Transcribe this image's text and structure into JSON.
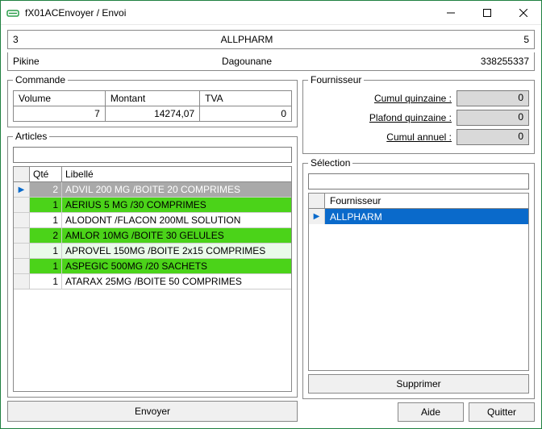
{
  "window": {
    "title": "fX01ACEnvoyer / Envoi"
  },
  "info1": {
    "left": "3",
    "center": "ALLPHARM",
    "right": "5"
  },
  "info2": {
    "left": "Pikine",
    "center": "Dagounane",
    "right": "338255337"
  },
  "commande": {
    "legend": "Commande",
    "headers": {
      "volume": "Volume",
      "montant": "Montant",
      "tva": "TVA"
    },
    "values": {
      "volume": "7",
      "montant": "14274,07",
      "tva": "0"
    }
  },
  "articles": {
    "legend": "Articles",
    "search": "",
    "headers": {
      "qte": "Qté",
      "libelle": "Libellé"
    },
    "rows": [
      {
        "qte": "2",
        "lib": "ADVIL 200 MG /BOITE 20 COMPRIMES",
        "style": "selected"
      },
      {
        "qte": "1",
        "lib": "AERIUS 5 MG /30 COMPRIMES",
        "style": "green"
      },
      {
        "qte": "1",
        "lib": "ALODONT /FLACON 200ML SOLUTION",
        "style": "plain"
      },
      {
        "qte": "2",
        "lib": "AMLOR 10MG /BOITE 30 GELULES",
        "style": "green"
      },
      {
        "qte": "1",
        "lib": "APROVEL 150MG /BOITE 2x15 COMPRIMES",
        "style": "even"
      },
      {
        "qte": "1",
        "lib": "ASPEGIC 500MG /20 SACHETS",
        "style": "green"
      },
      {
        "qte": "1",
        "lib": "ATARAX 25MG /BOITE 50 COMPRIMES",
        "style": "plain"
      }
    ],
    "envoyer": "Envoyer"
  },
  "fournisseur": {
    "legend": "Fournisseur",
    "cumul_quinzaine_label": "Cumul quinzaine :",
    "cumul_quinzaine": "0",
    "plafond_quinzaine_label": "Plafond quinzaine :",
    "plafond_quinzaine": "0",
    "cumul_annuel_label": "Cumul annuel :",
    "cumul_annuel": "0"
  },
  "selection": {
    "legend": "Sélection",
    "search": "",
    "header": "Fournisseur",
    "rows": [
      {
        "name": "ALLPHARM"
      }
    ],
    "supprimer": "Supprimer"
  },
  "buttons": {
    "aide": "Aide",
    "quitter": "Quitter"
  }
}
